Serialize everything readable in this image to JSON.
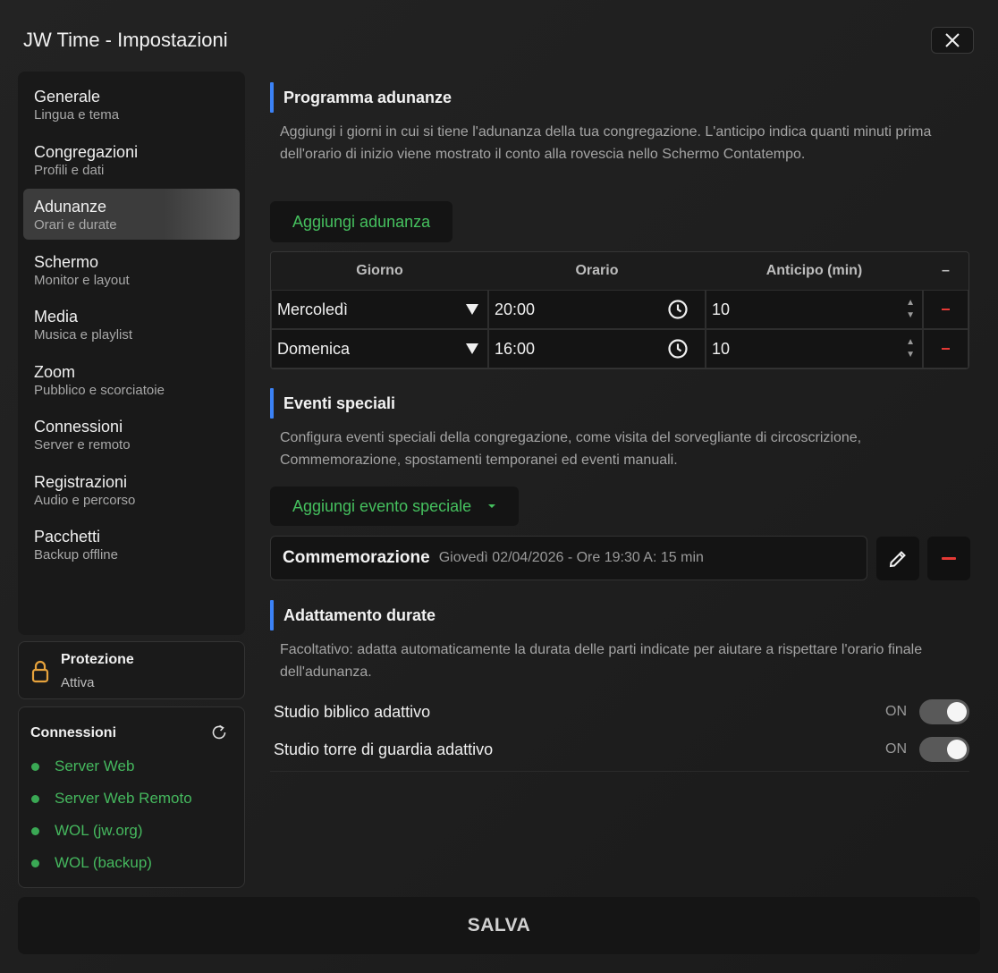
{
  "window": {
    "title": "JW Time - Impostazioni",
    "close_icon": "close-icon"
  },
  "sidebar": {
    "items": [
      {
        "label": "Generale",
        "sub": "Lingua e tema"
      },
      {
        "label": "Congregazioni",
        "sub": "Profili e dati"
      },
      {
        "label": "Adunanze",
        "sub": "Orari e durate",
        "active": true
      },
      {
        "label": "Schermo",
        "sub": "Monitor e layout"
      },
      {
        "label": "Media",
        "sub": "Musica e playlist"
      },
      {
        "label": "Zoom",
        "sub": "Pubblico e scorciatoie"
      },
      {
        "label": "Connessioni",
        "sub": "Server e remoto"
      },
      {
        "label": "Registrazioni",
        "sub": "Audio e percorso"
      },
      {
        "label": "Pacchetti",
        "sub": "Backup offline"
      }
    ]
  },
  "protection": {
    "title": "Protezione",
    "status": "Attiva",
    "icon": "lock-icon",
    "color": "#e6a23c"
  },
  "connections": {
    "title": "Connessioni",
    "refresh_icon": "refresh-icon",
    "items": [
      "Server Web",
      "Server Web Remoto",
      "WOL (jw.org)",
      "WOL (backup)"
    ],
    "status_color": "#3aa854"
  },
  "meetings": {
    "title": "Programma adunanze",
    "description": "Aggiungi i giorni in cui si tiene l'adunanza della tua congregazione. L'anticipo indica quanti minuti prima dell'orario di inizio viene mostrato il conto alla rovescia nello Schermo Contatempo.",
    "add_label": "Aggiungi adunanza",
    "columns": [
      "Giorno",
      "Orario",
      "Anticipo (min)",
      "–"
    ],
    "rows": [
      {
        "day": "Mercoledì",
        "time": "20:00",
        "advance": "10"
      },
      {
        "day": "Domenica",
        "time": "16:00",
        "advance": "10"
      }
    ]
  },
  "special_events": {
    "title": "Eventi speciali",
    "description": "Configura eventi speciali della congregazione, come visita del sorvegliante di circoscrizione, Commemorazione, spostamenti temporanei ed eventi manuali.",
    "add_label": "Aggiungi evento speciale",
    "events": [
      {
        "name": "Commemorazione",
        "info": "Giovedì 02/04/2026 - Ore 19:30 A: 15 min"
      }
    ]
  },
  "durations": {
    "title": "Adattamento durate",
    "description": "Facoltativo: adatta automaticamente la durata delle parti indicate per aiutare a rispettare l'orario finale dell'adunanza.",
    "toggles": [
      {
        "label": "Studio biblico adattivo",
        "state": "ON",
        "on": true
      },
      {
        "label": "Studio torre di guardia adattivo",
        "state": "ON",
        "on": true
      }
    ]
  },
  "save_label": "SALVA",
  "accent_color": "#3b82f6",
  "green_color": "#45c05e",
  "danger_color": "#e53935"
}
